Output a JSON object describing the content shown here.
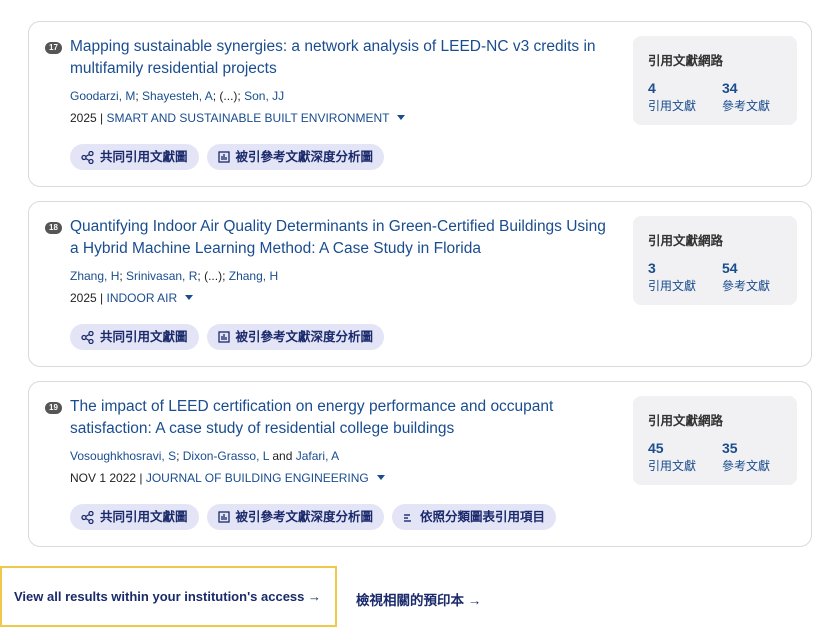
{
  "results": [
    {
      "number": "17",
      "title": "Mapping sustainable synergies: a network analysis of LEED-NC v3 credits in multifamily residential projects",
      "authors": [
        "Goodarzi, M",
        "Shayesteh, A"
      ],
      "authors_more": "(...)",
      "last_author": "Son, JJ",
      "date": "2025",
      "journal": "SMART AND SUSTAINABLE BUILT ENVIRONMENT",
      "network_title": "引用文獻網路",
      "citations": "4",
      "citations_label": "引用文獻",
      "references": "34",
      "references_label": "參考文獻",
      "actions": [
        "共同引用文獻圖",
        "被引參考文獻深度分析圖"
      ]
    },
    {
      "number": "18",
      "title": "Quantifying Indoor Air Quality Determinants in Green-Certified Buildings Using a Hybrid Machine Learning Method: A Case Study in Florida",
      "authors": [
        "Zhang, H",
        "Srinivasan, R"
      ],
      "authors_more": "(...)",
      "last_author": "Zhang, H",
      "date": "2025",
      "journal": "INDOOR AIR",
      "network_title": "引用文獻網路",
      "citations": "3",
      "citations_label": "引用文獻",
      "references": "54",
      "references_label": "參考文獻",
      "actions": [
        "共同引用文獻圖",
        "被引參考文獻深度分析圖"
      ]
    },
    {
      "number": "19",
      "title": "The impact of LEED certification on energy performance and occupant satisfaction: A case study of residential college buildings",
      "authors": [
        "Vosoughkhosravi, S",
        "Dixon-Grasso, L"
      ],
      "authors_and": "and",
      "last_author": "Jafari, A",
      "date": "NOV 1 2022",
      "journal": "JOURNAL OF BUILDING ENGINEERING",
      "network_title": "引用文獻網路",
      "citations": "45",
      "citations_label": "引用文獻",
      "references": "35",
      "references_label": "參考文獻",
      "actions": [
        "共同引用文獻圖",
        "被引參考文獻深度分析圖",
        "依照分類圖表引用項目"
      ]
    }
  ],
  "footer": {
    "view_all": "View all results within your institution's access →",
    "related": "檢視相關的預印本 →"
  },
  "icons": {
    "co_citation": "share-nodes-icon",
    "deep_analysis": "chart-box-icon",
    "classify": "list-lines-icon"
  },
  "colors": {
    "link": "#1a4d8f",
    "pill_bg": "#e4e4f7",
    "focus_border": "#f0c94a"
  }
}
